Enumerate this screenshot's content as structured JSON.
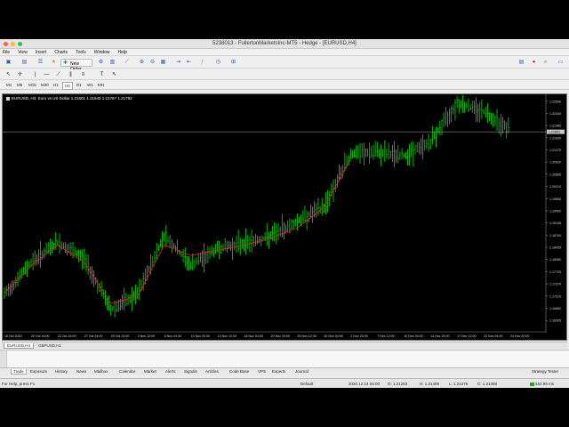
{
  "window": {
    "title": "5238013 - FullertonMarketsInc-MT5 - Hedge - [EURUSD,H4]"
  },
  "menu": [
    "File",
    "View",
    "Insert",
    "Charts",
    "Tools",
    "Window",
    "Help"
  ],
  "toolbar": {
    "new_order_label": "New Order"
  },
  "timeframes": [
    "M1",
    "M5",
    "M15",
    "M30",
    "H1",
    "H4",
    "D1",
    "W1",
    "MN"
  ],
  "active_timeframe": "H4",
  "chart_info": "EURUSD, H4:  Euro vs US Dollar  1.21601  1.21640  1.21767  1.21792",
  "chart_tabs": [
    "EURUSD,H4",
    "GBPUSD,H1"
  ],
  "terminal_tabs": [
    "Trade",
    "Exposure",
    "History",
    "News",
    "Mailbox",
    "Calendar",
    "Market",
    "Alerts",
    "Signals",
    "Articles",
    "Code Base",
    "VPS",
    "Experts",
    "Journal"
  ],
  "strategy_tester": "Strategy Tester",
  "status": {
    "help": "For Help, press F1",
    "profile": "Default",
    "datetime": "2020.12.14 04:00",
    "open": "O: 1.21283",
    "high": "H: 1.21409",
    "low": "L: 1.21276",
    "close": "C: 1.21398",
    "traffic": "163.99 ms"
  },
  "colors": {
    "bull": "#00ff00",
    "ma": "#ff2020",
    "bg": "#000000",
    "price_line": "#b0b0b0"
  },
  "chart_data": {
    "type": "line",
    "symbol": "EURUSD",
    "timeframe": "H4",
    "y_ticks": [
      "1.22690",
      "1.22340",
      "1.21985",
      "1.21630",
      "1.21275",
      "1.20920",
      "1.20565",
      "1.20210",
      "1.19855",
      "1.19500",
      "1.19145",
      "1.18790",
      "1.18435",
      "1.18080",
      "1.17725",
      "1.17370",
      "1.17015",
      "1.16660",
      "1.16305"
    ],
    "current_price_label": "1.21801",
    "current_price": 1.21801,
    "ylim": [
      1.16,
      1.2279
    ],
    "x_ticks": [
      "16 Oct 2020",
      "20 Oct 16:00",
      "22 Oct 16:00",
      "27 Oct 04:00",
      "29 Oct 20:00",
      "3 Nov 12:00",
      "6 Nov 04:00",
      "10 Nov 20:00",
      "13 Nov 12:00",
      "18 Nov 04:00",
      "20 Nov 20:00",
      "25 Nov 12:00",
      "30 Nov 04:00",
      "2 Dec 20:00",
      "7 Dec 12:00",
      "10 Dec 04:00",
      "14 Dec 20:00",
      "17 Dec 12:00",
      "22 Dec 04:00",
      "24 Dec 20:00"
    ],
    "price_series": {
      "name": "EURUSD",
      "x": [
        "16 Oct 2020",
        "20 Oct 16:00",
        "22 Oct 16:00",
        "27 Oct 04:00",
        "29 Oct 20:00",
        "3 Nov 12:00",
        "6 Nov 04:00",
        "10 Nov 20:00",
        "13 Nov 12:00",
        "18 Nov 04:00",
        "20 Nov 20:00",
        "25 Nov 12:00",
        "30 Nov 04:00",
        "2 Dec 20:00",
        "7 Dec 12:00",
        "10 Dec 04:00",
        "14 Dec 20:00",
        "17 Dec 12:00",
        "22 Dec 04:00",
        "24 Dec 20:00"
      ],
      "values": [
        1.1705,
        1.18,
        1.1858,
        1.181,
        1.1662,
        1.1705,
        1.188,
        1.179,
        1.184,
        1.1855,
        1.1875,
        1.192,
        1.196,
        1.2115,
        1.212,
        1.211,
        1.215,
        1.2265,
        1.224,
        1.2185
      ]
    },
    "ma_series": {
      "x": [
        "16 Oct 2020",
        "20 Oct 16:00",
        "22 Oct 16:00",
        "27 Oct 04:00",
        "29 Oct 20:00",
        "3 Nov 12:00",
        "6 Nov 04:00",
        "10 Nov 20:00",
        "13 Nov 12:00",
        "18 Nov 04:00",
        "20 Nov 20:00",
        "25 Nov 12:00",
        "30 Nov 04:00",
        "2 Dec 20:00"
      ],
      "values": [
        1.171,
        1.179,
        1.185,
        1.18,
        1.168,
        1.17,
        1.185,
        1.182,
        1.1835,
        1.185,
        1.187,
        1.19,
        1.196,
        1.21
      ]
    }
  }
}
